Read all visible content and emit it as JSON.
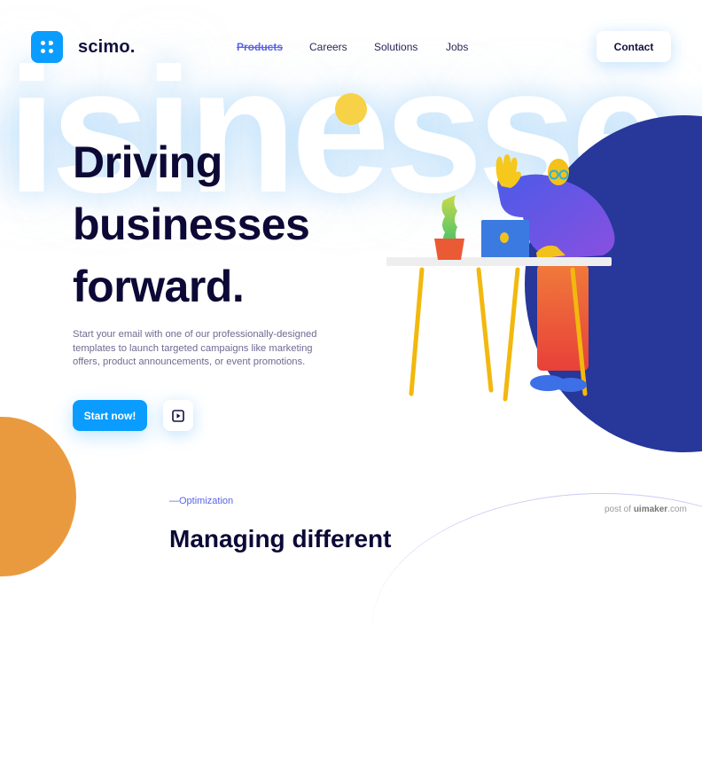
{
  "brand": {
    "name": "scimo.",
    "logo_icon": "scimo-logo-icon",
    "logo_color": "#0a9dff"
  },
  "nav": {
    "items": [
      {
        "label": "Products",
        "active": true
      },
      {
        "label": "Careers",
        "active": false
      },
      {
        "label": "Solutions",
        "active": false
      },
      {
        "label": "Jobs",
        "active": false
      }
    ],
    "contact_label": "Contact"
  },
  "background_word": "isinesse",
  "hero": {
    "title_lines": [
      "Driving",
      "businesses",
      "forward."
    ],
    "description": "Start your email with one of our professionally-designed templates to launch targeted campaigns like marketing offers, product announcements, or event promotions.",
    "cta_label": "Start now!",
    "play_icon": "play-icon"
  },
  "section": {
    "label": "—Optimization",
    "heading_partial": "Managing different"
  },
  "watermark": {
    "prefix": "post of ",
    "brand": "uimaker",
    "suffix": ".com"
  },
  "colors": {
    "accent": "#0a9dff",
    "navy": "#27379a",
    "orange": "#ea9a3e",
    "yellow": "#f7d146",
    "text_dark": "#0c0936",
    "link_active": "#5a63e8"
  },
  "illustration": {
    "description": "3D character waving at laptop on desk with plant"
  }
}
